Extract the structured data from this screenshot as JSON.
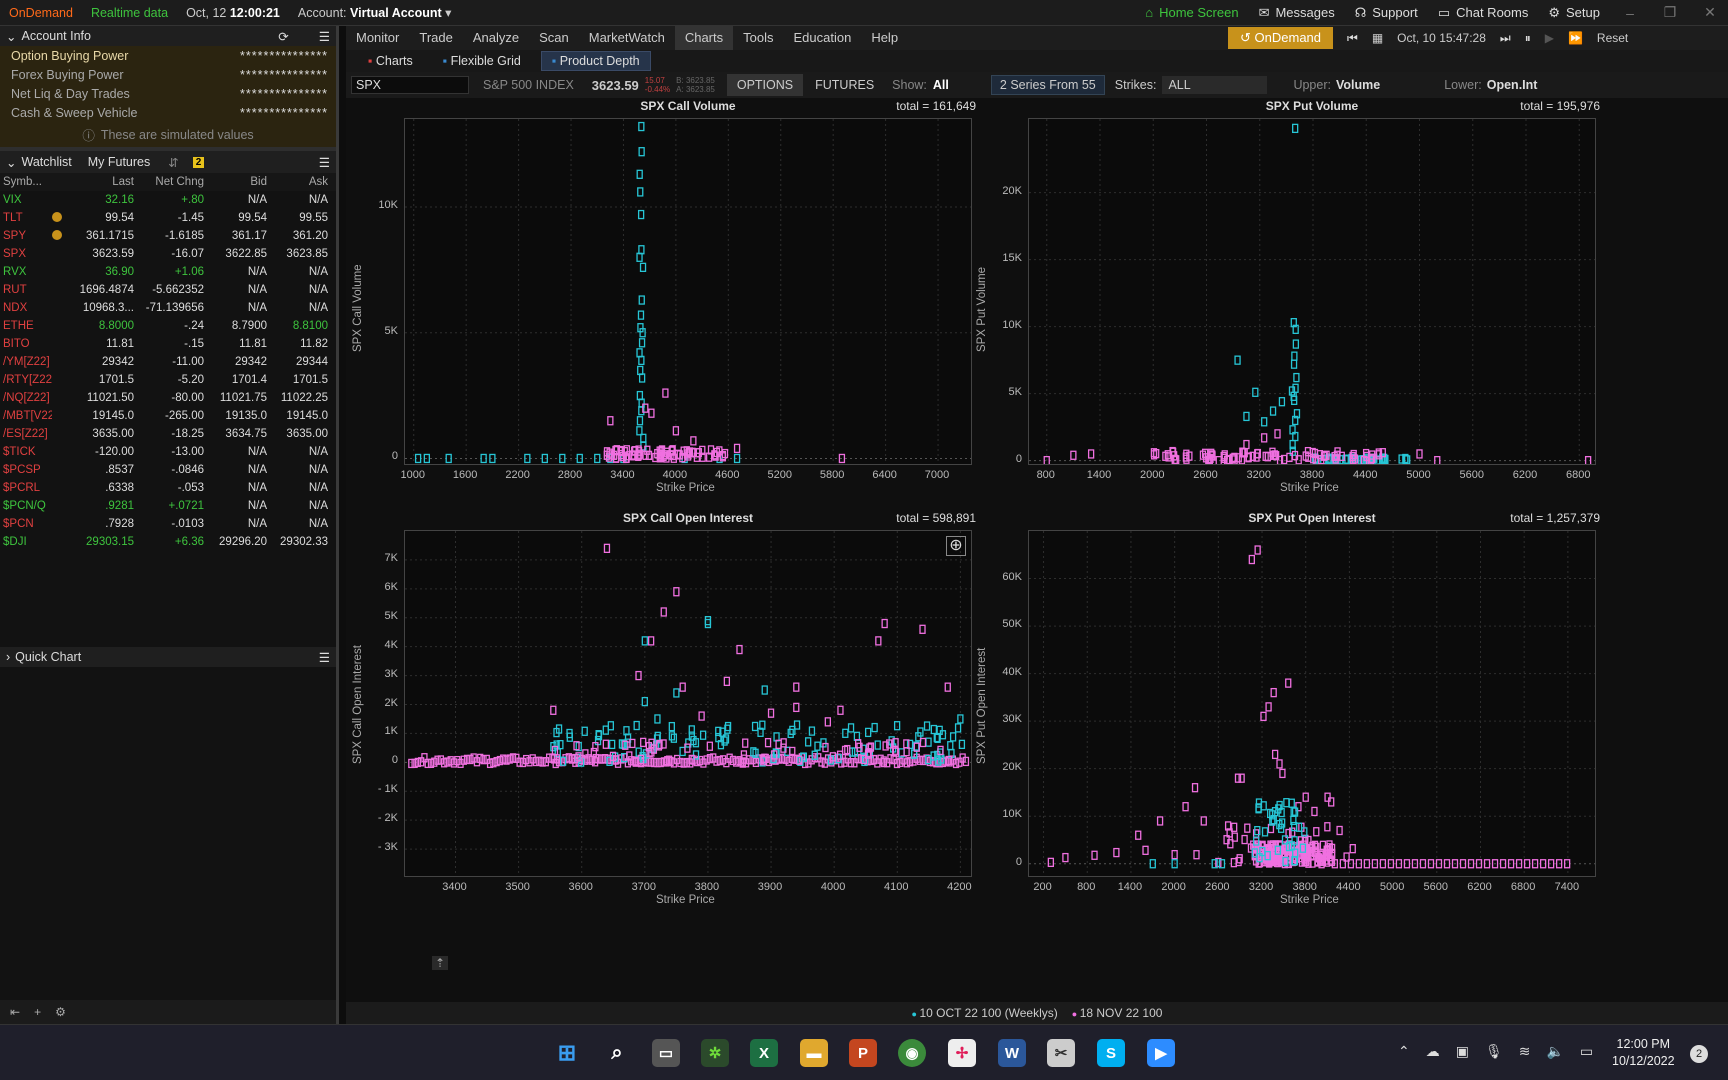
{
  "topbar": {
    "brand": "OnDemand",
    "realtime": "Realtime data",
    "date": "Oct, 12",
    "time": "12:00:21",
    "account_label": "Account:",
    "account": "Virtual Account",
    "home": "Home Screen",
    "messages": "Messages",
    "support": "Support",
    "chat": "Chat Rooms",
    "setup": "Setup"
  },
  "account_info": {
    "title": "Account Info",
    "rows": [
      {
        "label": "Option Buying Power",
        "value": "***************"
      },
      {
        "label": "Forex Buying Power",
        "value": "***************"
      },
      {
        "label": "Net Liq & Day Trades",
        "value": "***************"
      },
      {
        "label": "Cash & Sweep Vehicle",
        "value": "***************"
      }
    ],
    "note": "These are simulated values"
  },
  "watchlist": {
    "title": "Watchlist",
    "list_name": "My Futures",
    "badge": "2",
    "columns": [
      "Symb...",
      "Last",
      "Net Chng",
      "Bid",
      "Ask"
    ],
    "rows": [
      {
        "sym": "VIX",
        "last": "32.16",
        "chg": "+.80",
        "bid": "N/A",
        "ask": "N/A",
        "cls": "pos",
        "ic": ""
      },
      {
        "sym": "TLT",
        "last": "99.54",
        "chg": "-1.45",
        "bid": "99.54",
        "ask": "99.55",
        "cls": "red",
        "ic": "e"
      },
      {
        "sym": "SPY",
        "last": "361.1715",
        "chg": "-1.6185",
        "bid": "361.17",
        "ask": "361.20",
        "cls": "red",
        "ic": "e"
      },
      {
        "sym": "SPX",
        "last": "3623.59",
        "chg": "-16.07",
        "bid": "3622.85",
        "ask": "3623.85",
        "cls": "red",
        "ic": ""
      },
      {
        "sym": "RVX",
        "last": "36.90",
        "chg": "+1.06",
        "bid": "N/A",
        "ask": "N/A",
        "cls": "pos",
        "ic": ""
      },
      {
        "sym": "RUT",
        "last": "1696.4874",
        "chg": "-5.662352",
        "bid": "N/A",
        "ask": "N/A",
        "cls": "red",
        "ic": ""
      },
      {
        "sym": "NDX",
        "last": "10968.3...",
        "chg": "-71.139656",
        "bid": "N/A",
        "ask": "N/A",
        "cls": "red",
        "ic": ""
      },
      {
        "sym": "ETHE",
        "last": "8.8000",
        "chg": "-.24",
        "bid": "8.7900",
        "ask": "8.8100",
        "cls": "red",
        "ic": ""
      },
      {
        "sym": "BITO",
        "last": "11.81",
        "chg": "-.15",
        "bid": "11.81",
        "ask": "11.82",
        "cls": "red",
        "ic": ""
      },
      {
        "sym": "/YM[Z22]",
        "last": "29342",
        "chg": "-11.00",
        "bid": "29342",
        "ask": "29344",
        "cls": "red",
        "ic": ""
      },
      {
        "sym": "/RTY[Z22]",
        "last": "1701.5",
        "chg": "-5.20",
        "bid": "1701.4",
        "ask": "1701.5",
        "cls": "red",
        "ic": ""
      },
      {
        "sym": "/NQ[Z22]",
        "last": "11021.50",
        "chg": "-80.00",
        "bid": "11021.75",
        "ask": "11022.25",
        "cls": "red",
        "ic": ""
      },
      {
        "sym": "/MBT[V22]",
        "last": "19145.0",
        "chg": "-265.00",
        "bid": "19135.0",
        "ask": "19145.0",
        "cls": "red",
        "ic": ""
      },
      {
        "sym": "/ES[Z22]",
        "last": "3635.00",
        "chg": "-18.25",
        "bid": "3634.75",
        "ask": "3635.00",
        "cls": "red",
        "ic": ""
      },
      {
        "sym": "$TICK",
        "last": "-120.00",
        "chg": "-13.00",
        "bid": "N/A",
        "ask": "N/A",
        "cls": "red",
        "ic": ""
      },
      {
        "sym": "$PCSP",
        "last": ".8537",
        "chg": "-.0846",
        "bid": "N/A",
        "ask": "N/A",
        "cls": "red",
        "ic": ""
      },
      {
        "sym": "$PCRL",
        "last": ".6338",
        "chg": "-.053",
        "bid": "N/A",
        "ask": "N/A",
        "cls": "red",
        "ic": ""
      },
      {
        "sym": "$PCN/Q",
        "last": ".9281",
        "chg": "+.0721",
        "bid": "N/A",
        "ask": "N/A",
        "cls": "pos",
        "ic": ""
      },
      {
        "sym": "$PCN",
        "last": ".7928",
        "chg": "-.0103",
        "bid": "N/A",
        "ask": "N/A",
        "cls": "red",
        "ic": ""
      },
      {
        "sym": "$DJI",
        "last": "29303.15",
        "chg": "+6.36",
        "bid": "29296.20",
        "ask": "29302.33",
        "cls": "pos",
        "ic": ""
      }
    ]
  },
  "quick_chart": "Quick Chart",
  "menu": [
    "Monitor",
    "Trade",
    "Analyze",
    "Scan",
    "MarketWatch",
    "Charts",
    "Tools",
    "Education",
    "Help"
  ],
  "ondemand": {
    "label": "OnDemand",
    "datetime": "Oct, 10 15:47:28",
    "reset": "Reset"
  },
  "subtabs": [
    "Charts",
    "Flexible Grid",
    "Product Depth"
  ],
  "optbar": {
    "symbol": "SPX",
    "index_name": "S&P 500 INDEX",
    "price": "3623.59",
    "chg1": "15.07",
    "chg2": "-0.44%",
    "b": "B: 3623.85",
    "a": "A: 3623.85",
    "options": "OPTIONS",
    "futures": "FUTURES",
    "show_label": "Show:",
    "show_val": "All",
    "series": "2 Series From 55",
    "strikes_label": "Strikes:",
    "strikes_val": "ALL",
    "upper_label": "Upper:",
    "upper_val": "Volume",
    "lower_label": "Lower:",
    "lower_val": "Open.Int"
  },
  "chart_data": [
    {
      "type": "scatter",
      "title": "SPX Call Volume",
      "total": "total = 161,649",
      "ylabel": "SPX Call Volume",
      "xlabel": "Strike Price",
      "xlim": [
        900,
        7400
      ],
      "ylim": [
        -300,
        13500
      ],
      "xticks": [
        1000,
        1600,
        2200,
        2800,
        3400,
        4000,
        4600,
        5200,
        5800,
        6400,
        7000
      ],
      "yticks": [
        0,
        5000,
        10000
      ],
      "ytick_labels": [
        "0",
        "5K",
        "10K"
      ],
      "peak_strike": 3600,
      "peak_value": 13200,
      "total_value": 161649
    },
    {
      "type": "scatter",
      "title": "SPX Put Volume",
      "total": "total = 195,976",
      "ylabel": "SPX Put Volume",
      "xlabel": "Strike Price",
      "xlim": [
        600,
        7000
      ],
      "ylim": [
        -400,
        25500
      ],
      "xticks": [
        800,
        1400,
        2000,
        2600,
        3200,
        3800,
        4400,
        5000,
        5600,
        6200,
        6800
      ],
      "yticks": [
        0,
        5000,
        10000,
        15000,
        20000
      ],
      "ytick_labels": [
        "0",
        "5K",
        "10K",
        "15K",
        "20K"
      ],
      "peak_strike": 3600,
      "peak_value": 24800,
      "total_value": 195976
    },
    {
      "type": "scatter",
      "title": "SPX Call Open Interest",
      "total": "total = 598,891",
      "ylabel": "SPX Call Open Interest",
      "xlabel": "Strike Price",
      "xlim": [
        3320,
        4220
      ],
      "ylim": [
        -4000,
        8000
      ],
      "xticks": [
        3400,
        3500,
        3600,
        3700,
        3800,
        3900,
        4000,
        4100,
        4200
      ],
      "yticks": [
        -3000,
        -2000,
        -1000,
        0,
        1000,
        2000,
        3000,
        4000,
        5000,
        6000,
        7000
      ],
      "ytick_labels": [
        "- 3K",
        "- 2K",
        "- 1K",
        "0",
        "1K",
        "2K",
        "3K",
        "4K",
        "5K",
        "6K",
        "7K"
      ],
      "total_value": 598891
    },
    {
      "type": "scatter",
      "title": "SPX Put Open Interest",
      "total": "total = 1,257,379",
      "ylabel": "SPX Put Open Interest",
      "xlabel": "Strike Price",
      "xlim": [
        0,
        7800
      ],
      "ylim": [
        -3000,
        70000
      ],
      "xticks": [
        200,
        800,
        1400,
        2000,
        2600,
        3200,
        3800,
        4400,
        5000,
        5600,
        6200,
        6800,
        7400
      ],
      "yticks": [
        0,
        10000,
        20000,
        30000,
        40000,
        50000,
        60000
      ],
      "ytick_labels": [
        "0",
        "10K",
        "20K",
        "30K",
        "40K",
        "50K",
        "60K"
      ],
      "peak_strike": 3200,
      "peak_value": 66000,
      "total_value": 1257379
    }
  ],
  "legend": {
    "series": [
      {
        "name": "10 OCT 22 100 (Weeklys)",
        "color": "#27c6d6"
      },
      {
        "name": "18 NOV 22 100",
        "color": "#f070e0"
      }
    ]
  },
  "taskbar": {
    "time": "12:00 PM",
    "date": "10/12/2022",
    "notif": "2"
  },
  "colors": {
    "call": "#27c6d6",
    "put": "#f070e0",
    "account_bg": "#2b2410",
    "ondemand": "#c8921b"
  }
}
